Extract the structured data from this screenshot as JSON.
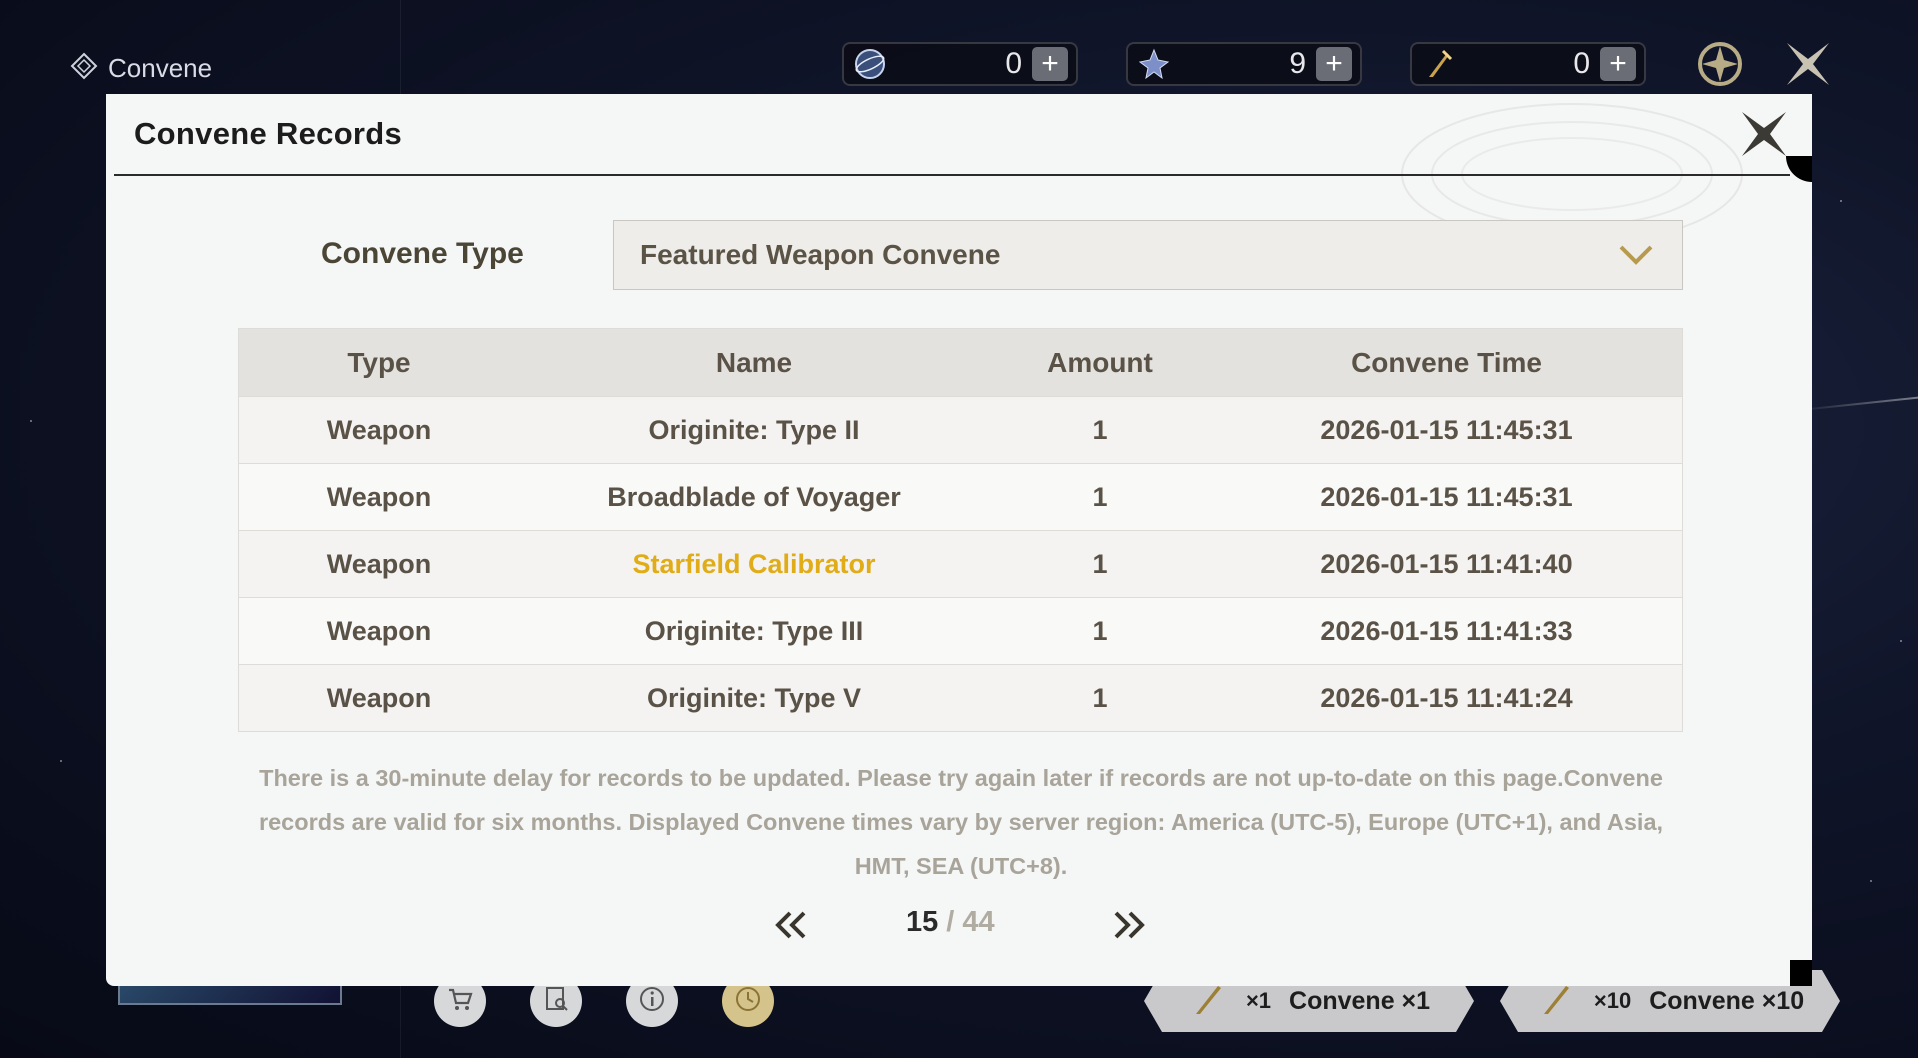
{
  "topbar": {
    "title": "Convene",
    "currencies": [
      {
        "icon": "astrite-icon",
        "value": "0"
      },
      {
        "icon": "lustrous-tide-icon",
        "value": "9"
      },
      {
        "icon": "forging-tide-icon",
        "value": "0"
      }
    ]
  },
  "modal": {
    "title": "Convene Records",
    "convene_type_label": "Convene Type",
    "convene_type_value": "Featured Weapon Convene",
    "table": {
      "headers": [
        "Type",
        "Name",
        "Amount",
        "Convene Time"
      ],
      "rows": [
        {
          "type": "Weapon",
          "name": "Originite: Type II",
          "amount": "1",
          "time": "2026-01-15 11:45:31",
          "highlight": false
        },
        {
          "type": "Weapon",
          "name": "Broadblade of Voyager",
          "amount": "1",
          "time": "2026-01-15 11:45:31",
          "highlight": false
        },
        {
          "type": "Weapon",
          "name": "Starfield Calibrator",
          "amount": "1",
          "time": "2026-01-15 11:41:40",
          "highlight": true
        },
        {
          "type": "Weapon",
          "name": "Originite: Type III",
          "amount": "1",
          "time": "2026-01-15 11:41:33",
          "highlight": false
        },
        {
          "type": "Weapon",
          "name": "Originite: Type V",
          "amount": "1",
          "time": "2026-01-15 11:41:24",
          "highlight": false
        }
      ]
    },
    "notice": "There is a 30-minute delay for records to be updated. Please try again later if records are not up-to-date on this page.Convene records are valid for six months. Displayed Convene times vary by server region: America (UTC-5), Europe (UTC+1), and Asia, HMT, SEA (UTC+8).",
    "pager": {
      "current": "15",
      "separator": "/",
      "total": "44"
    }
  },
  "bottom": {
    "convene_single": {
      "count": "×1",
      "label": "Convene ×1"
    },
    "convene_ten": {
      "count": "×10",
      "label": "Convene ×10"
    }
  },
  "colors": {
    "highlight": "#e0ac17",
    "accent": "#c6a655",
    "text": "#5a5246"
  }
}
